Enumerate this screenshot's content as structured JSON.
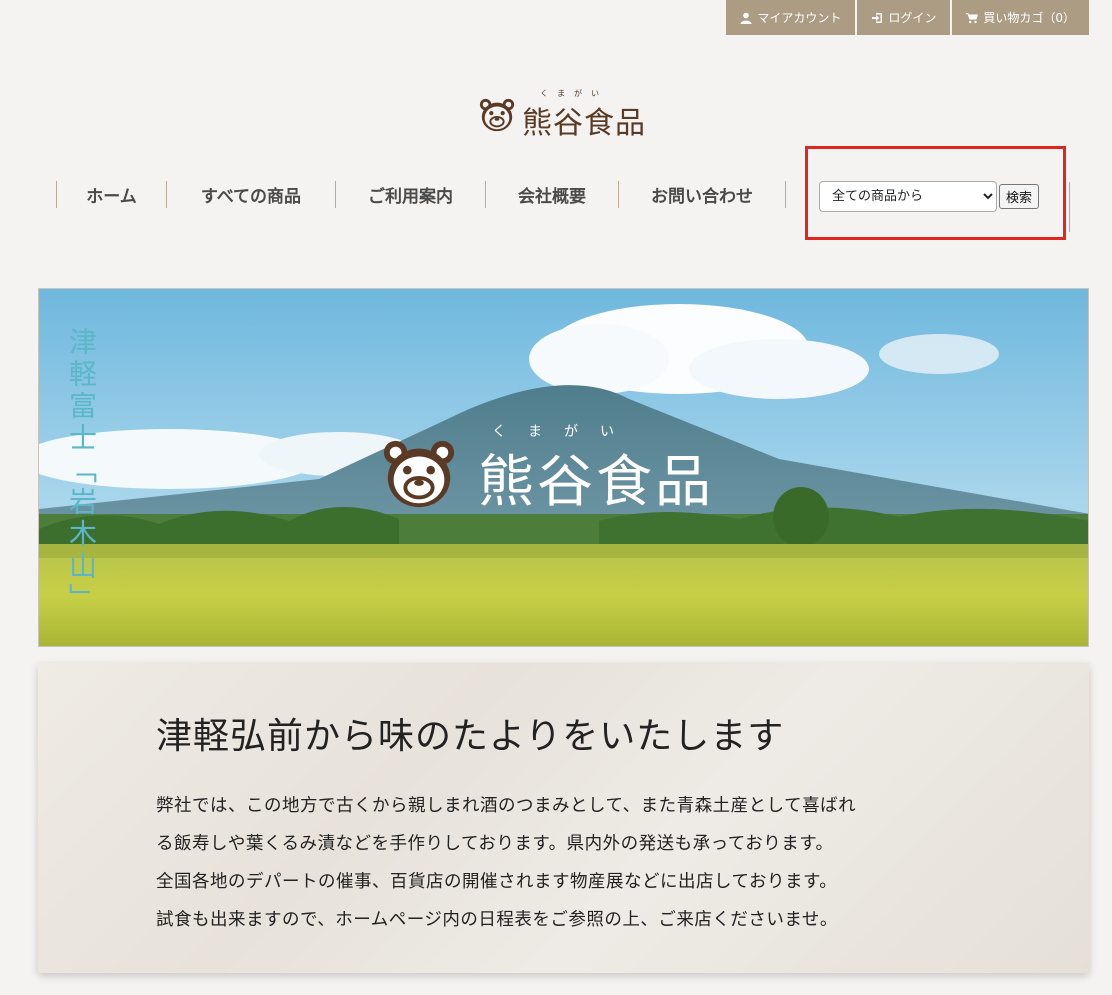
{
  "topbar": {
    "my_account": "マイアカウント",
    "login": "ログイン",
    "cart": "買い物カゴ（0）"
  },
  "logo": {
    "ruby": "くまがい",
    "name": "熊谷食品"
  },
  "nav": {
    "items": [
      "ホーム",
      "すべての商品",
      "ご利用案内",
      "会社概要",
      "お問い合わせ"
    ]
  },
  "search": {
    "scope_selected": "全ての商品から",
    "button": "検索"
  },
  "hero": {
    "vertical_text": "津軽富士「岩木山」",
    "logo_ruby": "くまがい",
    "logo_name": "熊谷食品"
  },
  "intro": {
    "heading": "津軽弘前から味のたよりをいたします",
    "lines": [
      "弊社では、この地方で古くから親しまれ酒のつまみとして、また青森土産として喜ばれ",
      "る飯寿しや葉くるみ漬などを手作りしております。県内外の発送も承っております。",
      "全国各地のデパートの催事、百貨店の開催されます物産展などに出店しております。",
      "試食も出来ますので、ホームページ内の日程表をご参照の上、ご来店くださいませ。"
    ]
  },
  "colors": {
    "topbar_bg": "#ab9c83",
    "highlight_border": "#e3251f",
    "logo_brown": "#5a3a25",
    "hero_vertical_text": "#5bb7c7"
  }
}
